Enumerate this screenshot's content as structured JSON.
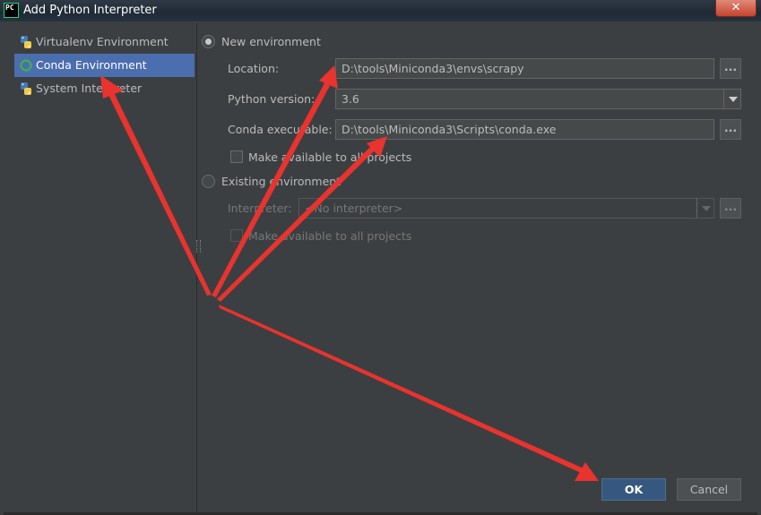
{
  "window": {
    "title": "Add Python Interpreter",
    "icon_text": "PC",
    "close_glyph": "✕"
  },
  "sidebar": {
    "items": [
      {
        "label": "Virtualenv Environment",
        "icon": "python-icon"
      },
      {
        "label": "Conda Environment",
        "icon": "conda-icon"
      },
      {
        "label": "System Interpreter",
        "icon": "python-icon"
      }
    ]
  },
  "new_env": {
    "radio_label": "New environment",
    "location_label": "Location:",
    "location_value": "D:\\tools\\Miniconda3\\envs\\scrapy",
    "python_version_label": "Python version:",
    "python_version_value": "3.6",
    "conda_exe_label": "Conda executable:",
    "conda_exe_value": "D:\\tools\\Miniconda3\\Scripts\\conda.exe",
    "make_available_label": "Make available to all projects",
    "browse_glyph": "..."
  },
  "existing_env": {
    "radio_label": "Existing environment",
    "interpreter_label": "Interpreter:",
    "interpreter_value": "<No interpreter>",
    "make_available_label": "Make available to all projects"
  },
  "buttons": {
    "ok": "OK",
    "cancel": "Cancel"
  },
  "colors": {
    "accent": "#4b6eaf",
    "ok_button": "#365880",
    "annotation_arrows": "#e8332e",
    "python_blue": "#3f7bb6",
    "python_yellow": "#f2c94c",
    "conda_green": "#43b049"
  }
}
